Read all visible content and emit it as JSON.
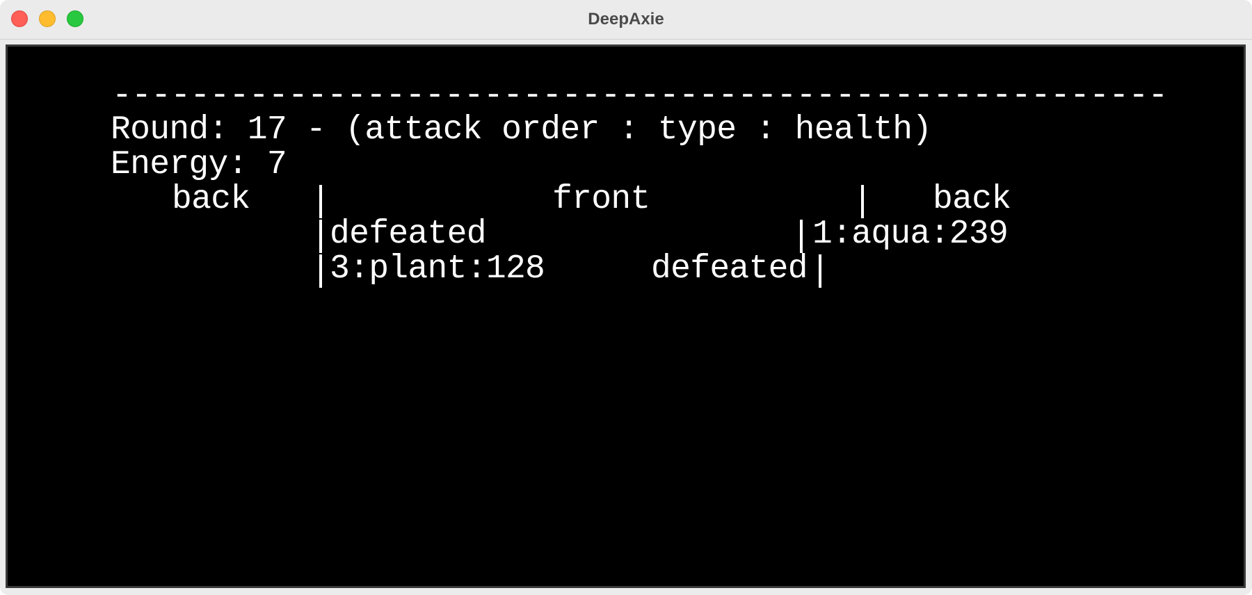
{
  "window": {
    "title": "DeepAxie"
  },
  "terminal": {
    "rule": "------------------------------------------------------",
    "round_line": "Round: 17 - (attack order : type : health)",
    "energy_line": "Energy: 7",
    "headers": {
      "left_back": "back",
      "front": "front",
      "right_back": "back"
    },
    "rows": [
      {
        "left_front": "defeated",
        "right_front": "1:aqua:239"
      },
      {
        "left_front": "3:plant:128",
        "right_front": "defeated"
      }
    ]
  }
}
